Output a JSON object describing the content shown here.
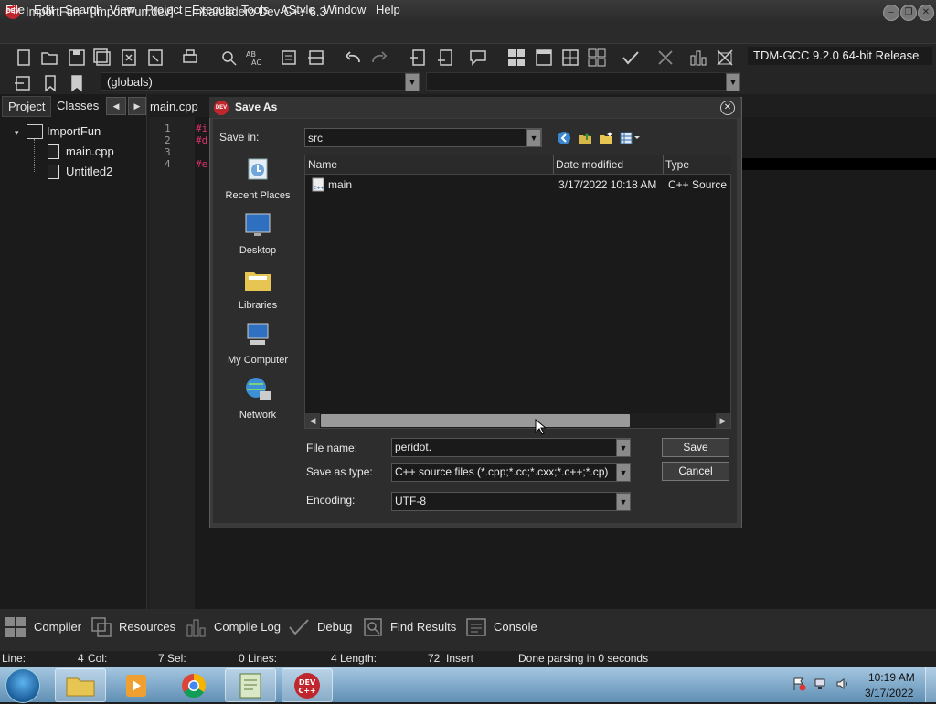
{
  "window": {
    "title": "ImportFun - [ImportFun.dev] - Embarcadero Dev-C++ 6.3",
    "logo_text": "DEV C++"
  },
  "menu": [
    "File",
    "Edit",
    "Search",
    "View",
    "Project",
    "Execute",
    "Tools",
    "AStyle",
    "Window",
    "Help"
  ],
  "toolbar": {
    "compiler": "TDM-GCC 9.2.0 64-bit Release",
    "class_scope": "(globals)"
  },
  "left_panel": {
    "tabs": [
      "Project",
      "Classes"
    ],
    "tree": {
      "root": "ImportFun",
      "children": [
        "main.cpp",
        "Untitled2"
      ]
    }
  },
  "editor": {
    "tab": "main.cpp",
    "line_numbers": [
      "1",
      "2",
      "3",
      "4"
    ],
    "visible_fragments": [
      "#i",
      "#d",
      "",
      "#e"
    ]
  },
  "dialog": {
    "title": "Save As",
    "save_in_label": "Save in:",
    "save_in_value": "src",
    "places": [
      "Recent Places",
      "Desktop",
      "Libraries",
      "My Computer",
      "Network"
    ],
    "columns": [
      "Name",
      "Date modified",
      "Type"
    ],
    "files": [
      {
        "name": "main",
        "date": "3/17/2022 10:18 AM",
        "type": "C++ Source I"
      }
    ],
    "file_name_label": "File name:",
    "file_name_value": "peridot.",
    "save_type_label": "Save as type:",
    "save_type_value": "C++ source files (*.cpp;*.cc;*.cxx;*.c++;*.cp)",
    "encoding_label": "Encoding:",
    "encoding_value": "UTF-8",
    "save_button": "Save",
    "cancel_button": "Cancel"
  },
  "bottom_tabs": [
    "Compiler",
    "Resources",
    "Compile Log",
    "Debug",
    "Find Results",
    "Console"
  ],
  "status": {
    "line_label": "Line:",
    "line": "4",
    "col_label": "Col:",
    "col": "7",
    "sel_label": "Sel:",
    "sel": "0",
    "lines_label": "Lines:",
    "lines": "4",
    "length_label": "Length:",
    "length": "72",
    "mode": "Insert",
    "message": "Done parsing in 0 seconds"
  },
  "taskbar": {
    "time": "10:19 AM",
    "date": "3/17/2022",
    "devcpp_label": "DEV C++"
  }
}
